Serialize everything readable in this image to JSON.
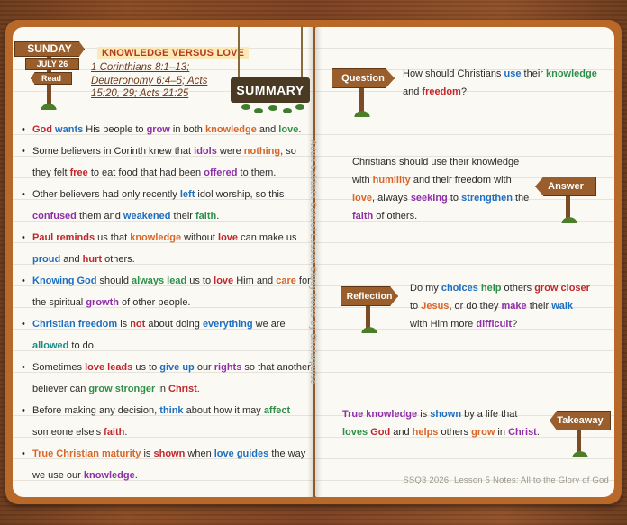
{
  "left": {
    "day": "SUNDAY",
    "date": "JULY 26",
    "read_label": "Read",
    "topic": "KNOWLEDGE VERSUS LOVE",
    "refs": "1 Corinthians 8:1–13; Deuteronomy 6:4–5; Acts 15:20, 29; Acts 21:25",
    "summary_label": "SUMMARY",
    "credit": "Adult Sabbath School Lesson Study Notes by Shofarpulse",
    "bullets": [
      [
        [
          "God",
          "red"
        ],
        [
          " wants ",
          "blue-kw"
        ],
        [
          "His people to ",
          ""
        ],
        [
          "grow",
          "purple"
        ],
        [
          " in both ",
          ""
        ],
        [
          "knowledge",
          "orange"
        ],
        [
          " and ",
          ""
        ],
        [
          "love",
          "green"
        ],
        [
          ".",
          ""
        ]
      ],
      [
        [
          "Some believers in Corinth knew that ",
          ""
        ],
        [
          "idols",
          "purple"
        ],
        [
          " were ",
          ""
        ],
        [
          "nothing",
          "orange"
        ],
        [
          ", so they felt ",
          ""
        ],
        [
          "free",
          "red"
        ],
        [
          " to eat food that had been ",
          ""
        ],
        [
          "offered",
          "purple"
        ],
        [
          " to them.",
          ""
        ]
      ],
      [
        [
          "Other believers had only recently ",
          ""
        ],
        [
          "left",
          "blue"
        ],
        [
          " idol worship, so this ",
          ""
        ],
        [
          "confused",
          "purple"
        ],
        [
          " them and ",
          ""
        ],
        [
          "weakened",
          "blue"
        ],
        [
          " their ",
          ""
        ],
        [
          "faith",
          "green"
        ],
        [
          ".",
          ""
        ]
      ],
      [
        [
          "Paul reminds",
          "red"
        ],
        [
          " us that ",
          ""
        ],
        [
          "knowledge",
          "orange"
        ],
        [
          " without ",
          ""
        ],
        [
          "love",
          "red"
        ],
        [
          " can make us ",
          ""
        ],
        [
          "proud",
          "blue"
        ],
        [
          " and ",
          ""
        ],
        [
          "hurt",
          "red"
        ],
        [
          " others.",
          ""
        ]
      ],
      [
        [
          "Knowing God",
          "blue"
        ],
        [
          " should ",
          ""
        ],
        [
          "always lead",
          "green"
        ],
        [
          " us to ",
          ""
        ],
        [
          "love",
          "red"
        ],
        [
          " Him and ",
          ""
        ],
        [
          "care",
          "orange"
        ],
        [
          " for the spiritual ",
          ""
        ],
        [
          "growth",
          "purple"
        ],
        [
          " of other people.",
          ""
        ]
      ],
      [
        [
          "Christian freedom",
          "blue"
        ],
        [
          " is ",
          ""
        ],
        [
          "not",
          "red"
        ],
        [
          " about doing ",
          ""
        ],
        [
          "everything",
          "blue"
        ],
        [
          " we are ",
          ""
        ],
        [
          "allowed",
          "teal"
        ],
        [
          " to do.",
          ""
        ]
      ],
      [
        [
          "Sometimes ",
          ""
        ],
        [
          "love leads",
          "red"
        ],
        [
          " us to ",
          ""
        ],
        [
          "give up",
          "blue"
        ],
        [
          " our ",
          ""
        ],
        [
          "rights",
          "purple"
        ],
        [
          " so that another believer can ",
          ""
        ],
        [
          "grow stronger",
          "green"
        ],
        [
          " in ",
          ""
        ],
        [
          "Christ",
          "red"
        ],
        [
          ".",
          ""
        ]
      ],
      [
        [
          "Before making any decision, ",
          ""
        ],
        [
          "think",
          "blue"
        ],
        [
          " about how it may ",
          ""
        ],
        [
          "affect",
          "green"
        ],
        [
          " someone else's ",
          ""
        ],
        [
          "faith",
          "red"
        ],
        [
          ".",
          ""
        ]
      ],
      [
        [
          "True Christian maturity",
          "orange"
        ],
        [
          " is ",
          ""
        ],
        [
          "shown",
          "red"
        ],
        [
          " when ",
          ""
        ],
        [
          "love guides",
          "blue"
        ],
        [
          " the way we use our ",
          ""
        ],
        [
          "knowledge",
          "purple"
        ],
        [
          ".",
          ""
        ]
      ]
    ]
  },
  "right": {
    "question_label": "Question",
    "question": [
      [
        "How should Christians ",
        ""
      ],
      [
        "use",
        "blue"
      ],
      [
        " their ",
        ""
      ],
      [
        "knowledge",
        "green"
      ],
      [
        " and ",
        ""
      ],
      [
        "freedom",
        "red"
      ],
      [
        "?",
        ""
      ]
    ],
    "answer_label": "Answer",
    "answer": [
      [
        "Christians should use their knowledge with ",
        ""
      ],
      [
        "humility",
        "orange"
      ],
      [
        " and their freedom with ",
        ""
      ],
      [
        "love",
        "orange"
      ],
      [
        ", always ",
        ""
      ],
      [
        "seeking",
        "purple"
      ],
      [
        " to ",
        ""
      ],
      [
        "strengthen",
        "blue"
      ],
      [
        " the ",
        ""
      ],
      [
        "faith",
        "purple"
      ],
      [
        " of others.",
        ""
      ]
    ],
    "reflection_label": "Reflection",
    "reflection": [
      [
        "Do my ",
        ""
      ],
      [
        "choices",
        "blue"
      ],
      [
        " ",
        ""
      ],
      [
        "help",
        "green"
      ],
      [
        " others ",
        ""
      ],
      [
        "grow closer",
        "red"
      ],
      [
        " to ",
        ""
      ],
      [
        "Jesus",
        "orange"
      ],
      [
        ", or do they ",
        ""
      ],
      [
        "make",
        "purple"
      ],
      [
        " their ",
        ""
      ],
      [
        "walk",
        "blue"
      ],
      [
        " with Him more ",
        ""
      ],
      [
        "difficult",
        "purple"
      ],
      [
        "?",
        ""
      ]
    ],
    "takeaway_label": "Takeaway",
    "takeaway": [
      [
        "True knowledge",
        "purple"
      ],
      [
        " is ",
        ""
      ],
      [
        "shown",
        "blue"
      ],
      [
        " by a life that ",
        ""
      ],
      [
        "loves",
        "green"
      ],
      [
        " ",
        ""
      ],
      [
        "God",
        "red"
      ],
      [
        " and ",
        ""
      ],
      [
        "helps",
        "orange"
      ],
      [
        " others ",
        ""
      ],
      [
        "grow",
        "orange"
      ],
      [
        " in ",
        ""
      ],
      [
        "Christ",
        "purple"
      ],
      [
        ".",
        ""
      ]
    ],
    "footer": "SSQ3 2026, Lesson 5 Notes: All to the Glory of God"
  },
  "colors": {
    "red": "#c0272d",
    "blue": "#1f6fc0",
    "purple": "#8e2fa8",
    "green": "#2f8f4a",
    "orange": "#d7662a",
    "teal": "#1a8a8a",
    "sign_wood": "#9a5e2c"
  }
}
